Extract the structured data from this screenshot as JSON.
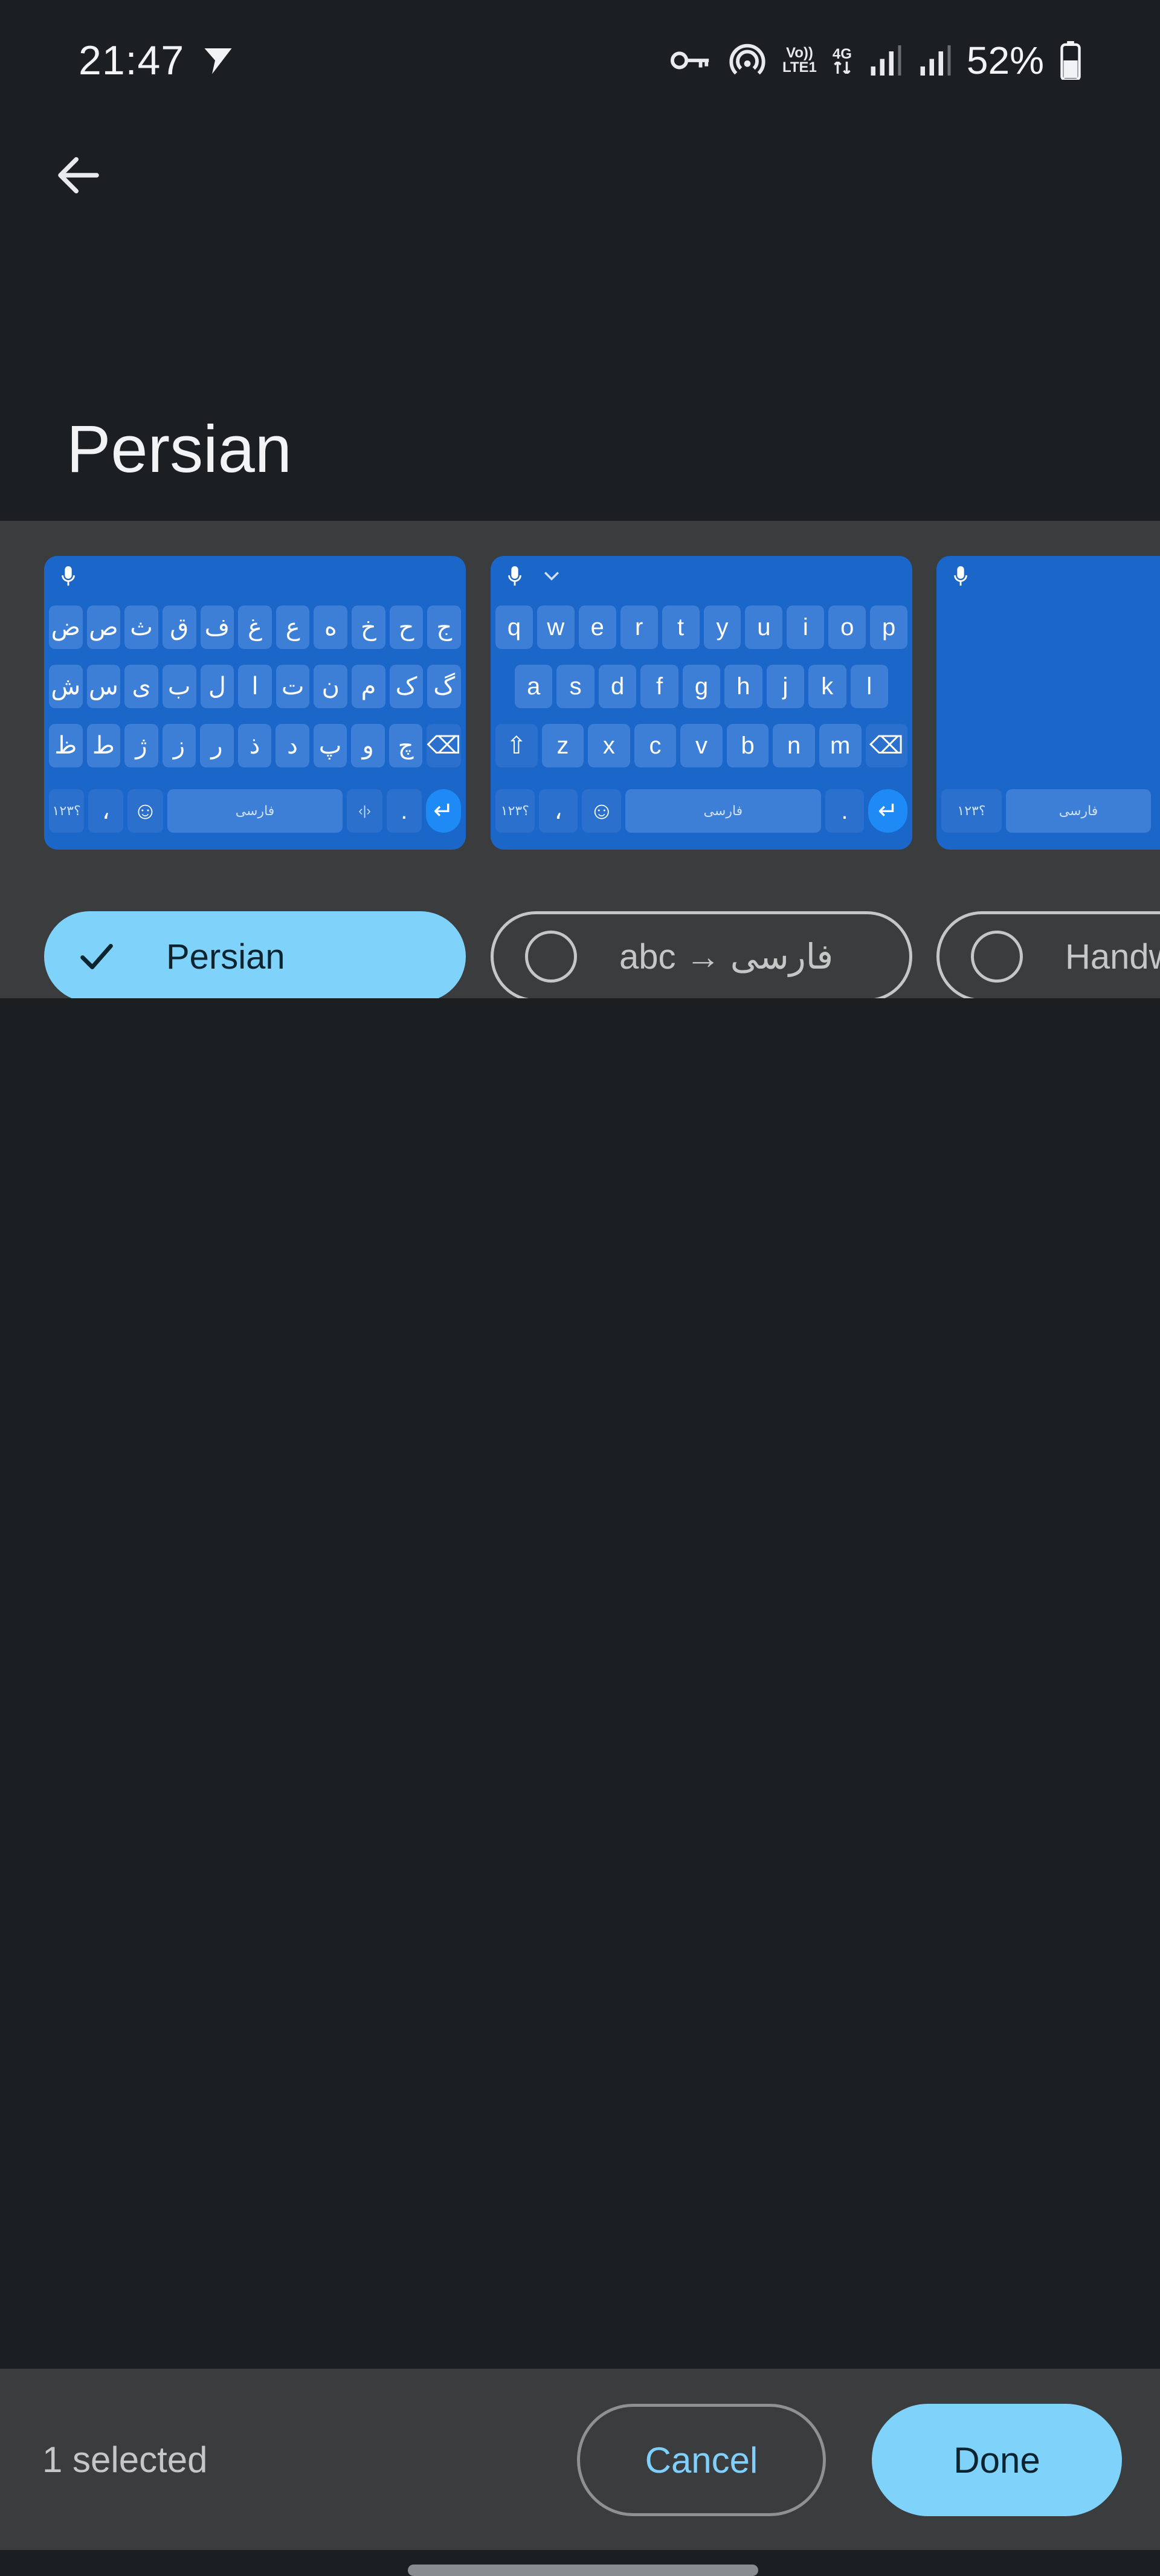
{
  "status_bar": {
    "time": "21:47",
    "network_top": "Vo))",
    "network_bottom": "LTE1",
    "gen_label": "4G",
    "battery_percent": "52%"
  },
  "header": {
    "title": "Persian"
  },
  "layouts": [
    {
      "label": "Persian",
      "selected": true
    },
    {
      "label": "abc → فارسی",
      "selected": false
    },
    {
      "label": "Handwriting",
      "selected": false
    }
  ],
  "keyboards": {
    "persian": {
      "row1": [
        "ض",
        "ص",
        "ث",
        "ق",
        "ف",
        "غ",
        "ع",
        "ه",
        "خ",
        "ح",
        "ج"
      ],
      "row2": [
        "ش",
        "س",
        "ی",
        "ب",
        "ل",
        "ا",
        "ت",
        "ن",
        "م",
        "ک",
        "گ"
      ],
      "row3": [
        "ظ",
        "ط",
        "ژ",
        "ز",
        "ر",
        "ذ",
        "د",
        "پ",
        "و",
        "چ",
        "⌫"
      ],
      "bottom": [
        "؟۱۲۳",
        "،",
        "☺",
        "فارسی",
        "‹|›",
        ".",
        "↵"
      ]
    },
    "qwerty": {
      "row1": [
        "q",
        "w",
        "e",
        "r",
        "t",
        "y",
        "u",
        "i",
        "o",
        "p"
      ],
      "row2": [
        "a",
        "s",
        "d",
        "f",
        "g",
        "h",
        "j",
        "k",
        "l"
      ],
      "row3": [
        "⇧",
        "z",
        "x",
        "c",
        "v",
        "b",
        "n",
        "m",
        "⌫"
      ],
      "bottom": [
        "؟۱۲۳",
        "،",
        "☺",
        "فارسی",
        ".",
        "↵"
      ]
    },
    "handwriting": {
      "bottom": [
        "؟۱۲۳",
        "فارسی"
      ]
    }
  },
  "footer": {
    "selected_count": "1 selected",
    "cancel_label": "Cancel",
    "done_label": "Done"
  },
  "colors": {
    "background": "#1b1f22",
    "strip": "#3a3c3e",
    "keyboard_blue": "#1a66c9",
    "accent": "#7fd3fb"
  }
}
